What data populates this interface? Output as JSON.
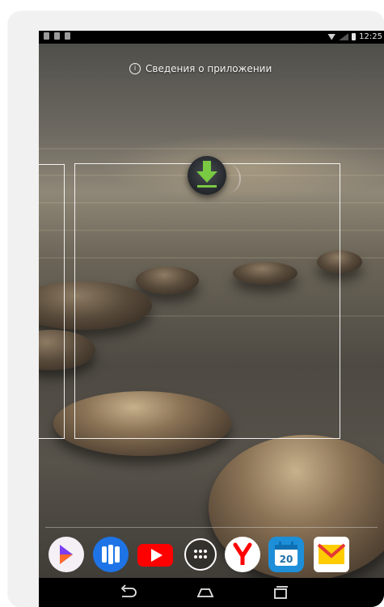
{
  "status_bar": {
    "time": "12:25",
    "icons": [
      "notification-icon",
      "notification-icon",
      "notification-icon",
      "wifi-icon",
      "signal-icon",
      "battery-icon"
    ]
  },
  "drag_hint": {
    "info_icon": "info-icon",
    "label": "Сведения о приложении"
  },
  "dragged_app": {
    "icon": "download-icon",
    "accent": "#7ac943"
  },
  "dock": {
    "apps": [
      {
        "name": "app-launcher-icon",
        "color": "#ffffff"
      },
      {
        "name": "maps-icon",
        "color": "#1e74e6"
      },
      {
        "name": "youtube-icon",
        "color": "#ff0000"
      },
      {
        "name": "all-apps-icon",
        "color": "#ffffff"
      },
      {
        "name": "yandex-icon",
        "color": "#ff0000"
      },
      {
        "name": "calendar-icon",
        "color": "#1d8fd9",
        "label": "20"
      },
      {
        "name": "mail-icon",
        "color": "#ffcc00"
      }
    ]
  },
  "navigation": {
    "buttons": [
      "back-icon",
      "home-icon",
      "recents-icon"
    ]
  }
}
